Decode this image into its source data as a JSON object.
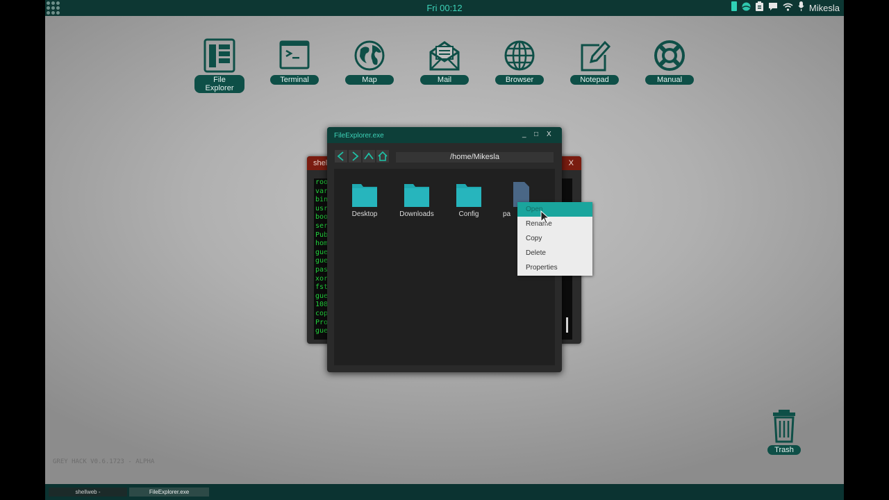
{
  "topbar": {
    "clock": "Fri 00:12",
    "user": "Mikesla",
    "icons": [
      "apps-grid-icon",
      "battery-icon",
      "network-ball-icon",
      "clipboard-icon",
      "chat-icon",
      "wifi-icon",
      "microphone-icon"
    ]
  },
  "desktop_icons": [
    {
      "label": "File Explorer",
      "icon": "file-explorer-icon"
    },
    {
      "label": "Terminal",
      "icon": "terminal-icon"
    },
    {
      "label": "Map",
      "icon": "globe-icon"
    },
    {
      "label": "Mail",
      "icon": "mail-icon"
    },
    {
      "label": "Browser",
      "icon": "browser-icon"
    },
    {
      "label": "Notepad",
      "icon": "notepad-icon"
    },
    {
      "label": "Manual",
      "icon": "lifebuoy-icon"
    }
  ],
  "back_window": {
    "title": "shell",
    "close": "X",
    "lines": [
      "roo",
      "var",
      "bin",
      "usr",
      "boo",
      "ser",
      "Pub",
      "hom",
      "gue",
      "gue",
      "pas",
      "xor",
      "fst",
      "gue",
      "108",
      "cop",
      "Pro",
      "gue"
    ]
  },
  "file_explorer": {
    "title": "FileExplorer.exe",
    "minimize": "_",
    "maximize": "□",
    "close": "X",
    "path": "/home/Mikesla",
    "files": [
      {
        "name": "Desktop",
        "type": "folder"
      },
      {
        "name": "Downloads",
        "type": "folder"
      },
      {
        "name": "Config",
        "type": "folder"
      },
      {
        "name": "pa",
        "type": "file"
      }
    ]
  },
  "context_menu": {
    "items": [
      "Open",
      "Rename",
      "Copy",
      "Delete",
      "Properties"
    ],
    "selected": "Open"
  },
  "trash": {
    "label": "Trash"
  },
  "version": "GREY HACK V0.6.1723 - ALPHA",
  "taskbar": {
    "tasks": [
      "shellweb -",
      "FileExplorer.exe"
    ]
  },
  "colors": {
    "accent": "#3dd2b8",
    "label_bg": "#0e4f47",
    "folder": "#1fa8b0",
    "highlight": "#1aa59d"
  }
}
